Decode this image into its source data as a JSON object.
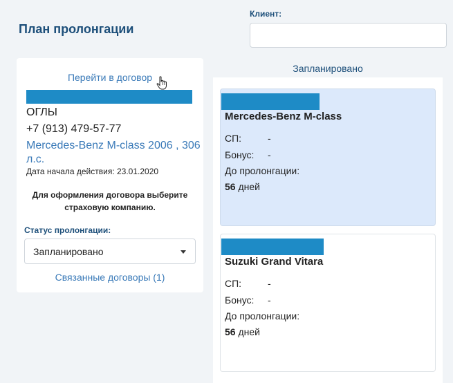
{
  "header": {
    "title": "План пролонгации",
    "client_label": "Клиент:",
    "client_value": ""
  },
  "left": {
    "goto_link": "Перейти в договор",
    "name": "ОГЛЫ",
    "phone": "+7 (913) 479-57-77",
    "car": "Mercedes-Benz M-class 2006 , 306 л.с.",
    "start_date": "Дата начала действия: 23.01.2020",
    "hint": "Для оформления договора выберите страховую компанию.",
    "status_label": "Статус пролонгации:",
    "status_value": "Запланировано",
    "related_link": "Связанные договоры (1)"
  },
  "column": {
    "heading": "Запланировано",
    "cards": [
      {
        "title": "Mercedes-Benz M-class",
        "sp_label": "СП:",
        "sp_value": "-",
        "bonus_label": "Бонус:",
        "bonus_value": "-",
        "until_label": "До пролонгации:",
        "days_number": "56",
        "days_unit": "дней"
      },
      {
        "title": "Suzuki Grand Vitara",
        "sp_label": "СП:",
        "sp_value": "-",
        "bonus_label": "Бонус:",
        "bonus_value": "-",
        "until_label": "До пролонгации:",
        "days_number": "56",
        "days_unit": "дней"
      }
    ]
  },
  "colors": {
    "accent": "#1d4f7a",
    "link": "#3a7ab8",
    "redaction": "#1e8bc6",
    "active_card": "#dce9fb"
  },
  "icons": {
    "cursor": "hand-pointer-icon",
    "caret": "caret-down-icon"
  }
}
